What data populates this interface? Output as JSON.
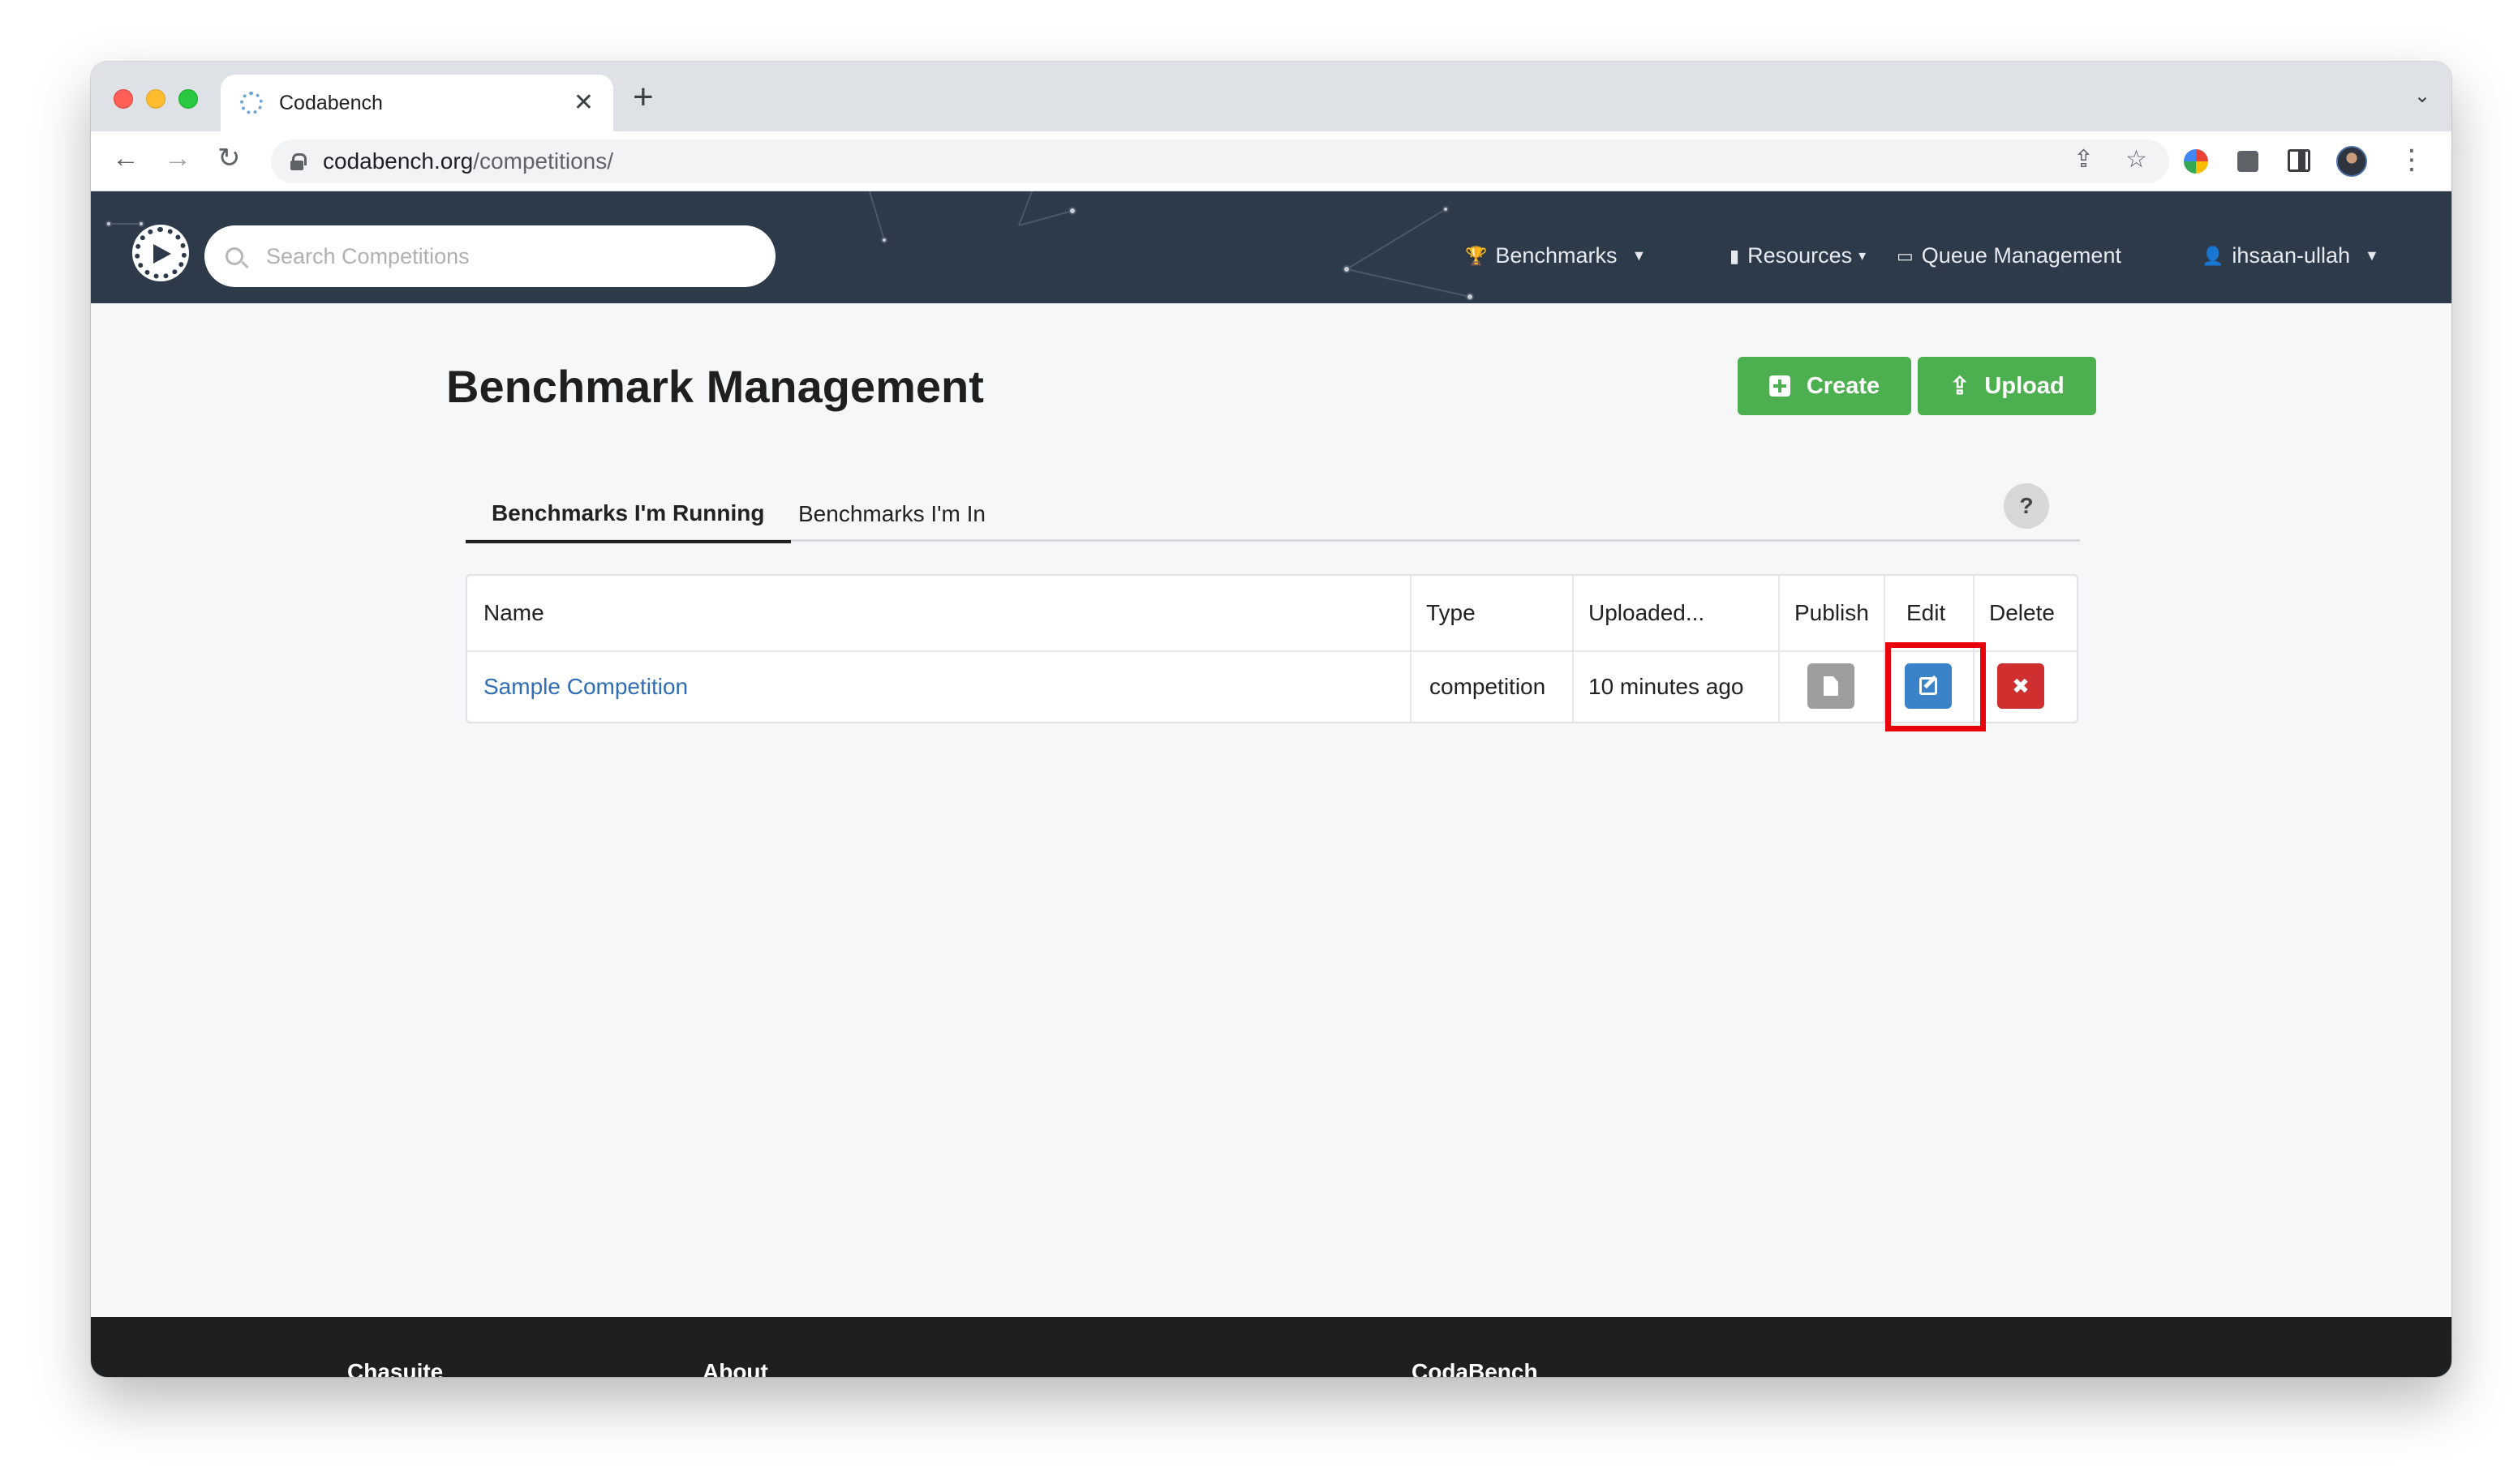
{
  "browser": {
    "tab_title": "Codabench",
    "tab_close": "✕",
    "new_tab": "+",
    "url_host": "codabench.org",
    "url_path": "/competitions/"
  },
  "navbar": {
    "search_placeholder": "Search Competitions",
    "benchmarks": "Benchmarks",
    "resources": "Resources",
    "queue_management": "Queue Management",
    "user": "ihsaan-ullah"
  },
  "page": {
    "title": "Benchmark Management",
    "create_label": "Create",
    "upload_label": "Upload"
  },
  "tabs": [
    {
      "label": "Benchmarks I'm Running",
      "active": true
    },
    {
      "label": "Benchmarks I'm In",
      "active": false
    }
  ],
  "help_label": "?",
  "table": {
    "headers": [
      "Name",
      "Type",
      "Uploaded...",
      "Publish",
      "Edit",
      "Delete"
    ],
    "rows": [
      {
        "name": "Sample Competition",
        "type": "competition",
        "uploaded": "10 minutes ago",
        "delete_glyph": "✖"
      }
    ]
  },
  "footer": {
    "col1": "Chasuite",
    "col2": "About",
    "col3": "CodaBench"
  },
  "colors": {
    "navbar_bg": "#2c3a4a",
    "accent_green": "#4caf50",
    "edit_blue": "#3b83c9",
    "delete_red": "#d02f2f",
    "highlight_red": "#e8000b"
  },
  "icons": [
    "search-icon",
    "trophy-icon",
    "document-icon",
    "monitor-icon",
    "user-icon",
    "plus-square-icon",
    "upload-icon",
    "edit-icon",
    "close-icon"
  ]
}
